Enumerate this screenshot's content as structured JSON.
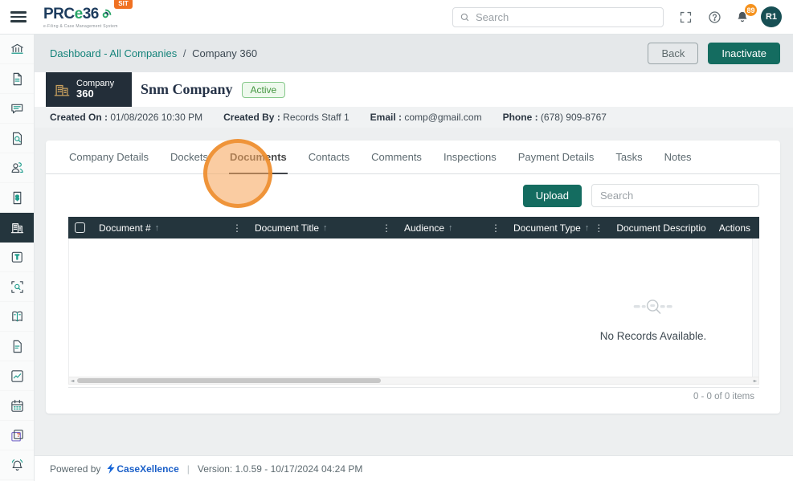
{
  "colors": {
    "teal": "#146c60",
    "orange": "#f07122",
    "header_dark": "#24353d",
    "link_teal": "#15837a",
    "badge_orange": "#f5921e"
  },
  "app_header": {
    "logo_prc": "PRC",
    "logo_e": "e",
    "logo_36": "36",
    "logo_tagline": "e-Filing & Case Management System",
    "env_badge": "SIT",
    "search_placeholder": "Search",
    "notification_count": "89",
    "avatar_initials": "R1"
  },
  "sidebar": {
    "items": [
      {
        "name": "sidebar-item-institution",
        "icon": "bank-icon"
      },
      {
        "name": "sidebar-item-filings",
        "icon": "file-lines-icon"
      },
      {
        "name": "sidebar-item-messages",
        "icon": "chat-icon"
      },
      {
        "name": "sidebar-item-record-search",
        "icon": "file-search-icon"
      },
      {
        "name": "sidebar-item-users",
        "icon": "users-icon"
      },
      {
        "name": "sidebar-item-invoices",
        "icon": "invoice-icon"
      },
      {
        "name": "sidebar-item-companies",
        "icon": "building-icon",
        "active": true
      },
      {
        "name": "sidebar-item-tasks",
        "icon": "task-note-icon"
      },
      {
        "name": "sidebar-item-scan-search",
        "icon": "scan-search-icon"
      },
      {
        "name": "sidebar-item-library",
        "icon": "book-icon"
      },
      {
        "name": "sidebar-item-documents",
        "icon": "doc-icon"
      },
      {
        "name": "sidebar-item-reports",
        "icon": "chart-icon"
      },
      {
        "name": "sidebar-item-calendar",
        "icon": "calendar-icon"
      },
      {
        "name": "sidebar-item-help",
        "icon": "help-stack-icon"
      },
      {
        "name": "sidebar-item-notifications",
        "icon": "bell-icon"
      }
    ]
  },
  "breadcrumb": {
    "link": "Dashboard - All Companies",
    "separator": "/",
    "current": "Company 360"
  },
  "page_actions": {
    "back": "Back",
    "inactivate": "Inactivate"
  },
  "company": {
    "badge_top": "Company",
    "badge_bottom": "360",
    "name": "Snm Company",
    "status": "Active"
  },
  "meta_items": [
    {
      "label": "Created On :",
      "value": "01/08/2026 10:30 PM"
    },
    {
      "label": "Created By :",
      "value": "Records Staff 1"
    },
    {
      "label": "Email :",
      "value": "comp@gmail.com"
    },
    {
      "label": "Phone :",
      "value": "(678) 909-8767"
    }
  ],
  "tabs": [
    {
      "name": "tab-company-details",
      "label": "Company Details"
    },
    {
      "name": "tab-dockets",
      "label": "Dockets"
    },
    {
      "name": "tab-documents",
      "label": "Documents",
      "active": true
    },
    {
      "name": "tab-contacts",
      "label": "Contacts"
    },
    {
      "name": "tab-comments",
      "label": "Comments"
    },
    {
      "name": "tab-inspections",
      "label": "Inspections"
    },
    {
      "name": "tab-payment-details",
      "label": "Payment Details"
    },
    {
      "name": "tab-tasks",
      "label": "Tasks"
    },
    {
      "name": "tab-notes",
      "label": "Notes"
    }
  ],
  "toolbar": {
    "upload": "Upload",
    "search_placeholder": "Search"
  },
  "table": {
    "columns": [
      {
        "name": "col-document-number",
        "label": "Document #",
        "width": 194,
        "sort": true,
        "menu": true
      },
      {
        "name": "col-document-title",
        "label": "Document Title",
        "width": 186,
        "sort": true,
        "menu": true
      },
      {
        "name": "col-audience",
        "label": "Audience",
        "width": 136,
        "sort": true,
        "menu": true
      },
      {
        "name": "col-document-type",
        "label": "Document Type",
        "width": 128,
        "sort": true,
        "menu": true
      },
      {
        "name": "col-document-description",
        "label": "Document Descriptio",
        "width": 110,
        "sort": false,
        "menu": false
      },
      {
        "name": "col-actions",
        "label": "Actions",
        "width": 58,
        "sort": false,
        "menu": true
      }
    ],
    "empty_message": "No Records Available.",
    "pager": "0 - 0 of 0 items"
  },
  "footer": {
    "powered_by": "Powered by",
    "brand": "CaseXellence",
    "separator": "|",
    "version": "Version: 1.0.59 - 10/17/2024 04:24 PM"
  }
}
